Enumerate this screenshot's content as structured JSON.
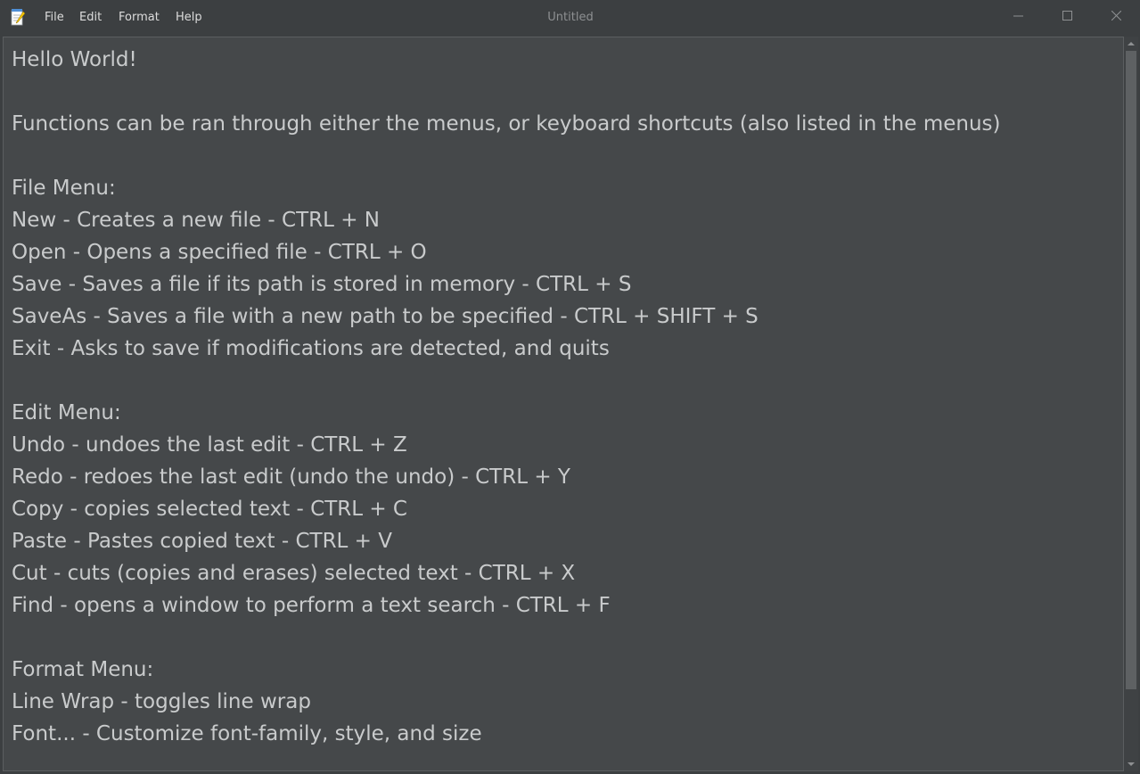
{
  "window": {
    "title": "Untitled"
  },
  "menubar": {
    "items": [
      "File",
      "Edit",
      "Format",
      "Help"
    ]
  },
  "editor": {
    "content": "Hello World!\n\nFunctions can be ran through either the menus, or keyboard shortcuts (also listed in the menus)\n\nFile Menu:\nNew - Creates a new file - CTRL + N\nOpen - Opens a specified file - CTRL + O\nSave - Saves a file if its path is stored in memory - CTRL + S\nSaveAs - Saves a file with a new path to be specified - CTRL + SHIFT + S\nExit - Asks to save if modifications are detected, and quits\n\nEdit Menu:\nUndo - undoes the last edit - CTRL + Z\nRedo - redoes the last edit (undo the undo) - CTRL + Y\nCopy - copies selected text - CTRL + C\nPaste - Pastes copied text - CTRL + V\nCut - cuts (copies and erases) selected text - CTRL + X\nFind - opens a window to perform a text search - CTRL + F\n\nFormat Menu:\nLine Wrap - toggles line wrap\nFont... - Customize font-family, style, and size"
  },
  "icons": {
    "app": "notepad-icon",
    "minimize": "minimize-icon",
    "maximize": "maximize-icon",
    "close": "close-icon"
  },
  "colors": {
    "titlebar_bg": "#3c3f41",
    "editor_bg": "#45484a",
    "text": "#c9cbcc",
    "menu_text": "#dcdcdc",
    "title_text": "#8e9092"
  }
}
